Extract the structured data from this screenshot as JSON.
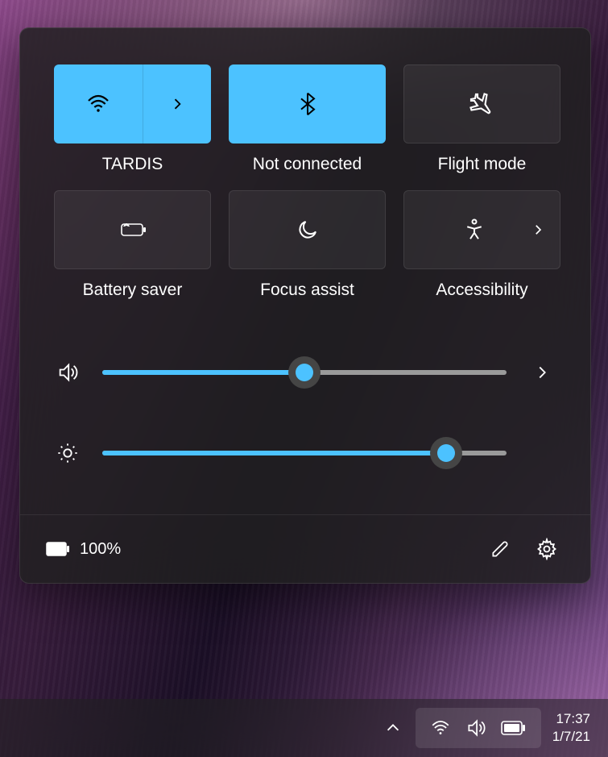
{
  "quick_settings": {
    "tiles": {
      "wifi": {
        "label": "TARDIS",
        "active": true
      },
      "bluetooth": {
        "label": "Not connected",
        "active": true
      },
      "flight_mode": {
        "label": "Flight mode",
        "active": false
      },
      "battery_saver": {
        "label": "Battery saver",
        "active": false
      },
      "focus_assist": {
        "label": "Focus assist",
        "active": false
      },
      "accessibility": {
        "label": "Accessibility",
        "active": false
      }
    },
    "sliders": {
      "volume": {
        "value": 50
      },
      "brightness": {
        "value": 85
      }
    },
    "footer": {
      "battery_text": "100%"
    }
  },
  "taskbar": {
    "time": "17:37",
    "date": "1/7/21"
  },
  "colors": {
    "accent": "#4cc2ff"
  }
}
